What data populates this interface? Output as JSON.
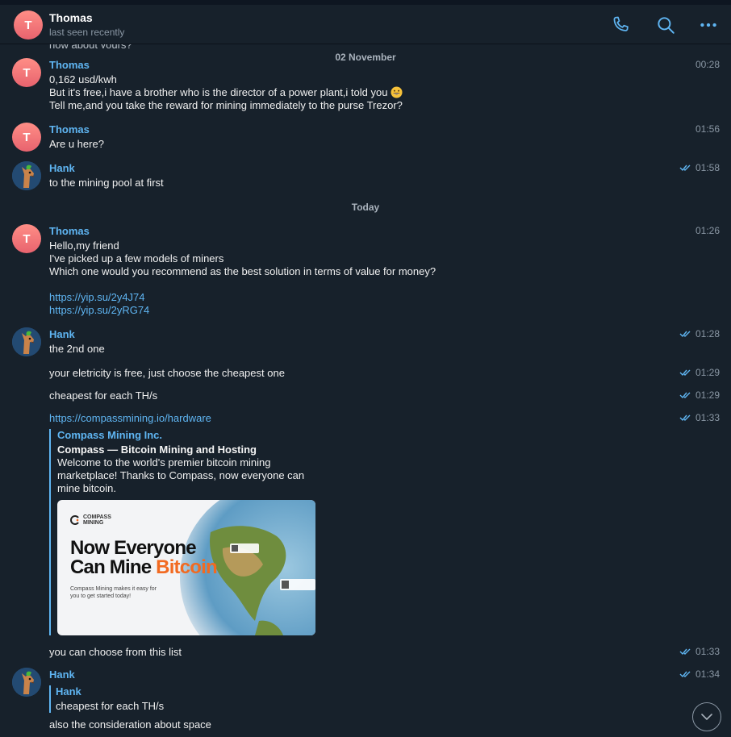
{
  "header": {
    "avatar_letter": "T",
    "name": "Thomas",
    "status": "last seen recently",
    "icons": [
      "phone-icon",
      "search-icon",
      "more-icon"
    ]
  },
  "cut_text": "now about yours?",
  "date_separators": [
    "02 November",
    "Today"
  ],
  "messages": [
    {
      "author": "Thomas",
      "time": "00:28",
      "lines": [
        "0,162 usd/kwh",
        "But it's free,i have a brother who is the director of a power plant,i told you",
        "Tell me,and you take the reward for mining immediately to the purse Trezor?"
      ]
    },
    {
      "author": "Thomas",
      "time": "01:56",
      "lines": [
        "Are u here?"
      ]
    },
    {
      "author": "Hank",
      "time": "01:58",
      "lines": [
        "to the mining pool at first"
      ]
    },
    {
      "author": "Thomas",
      "time": "01:26",
      "lines": [
        "Hello,my friend",
        "I've picked up a few models of miners",
        "Which one would you recommend as the best solution in terms of value for money?"
      ],
      "links": [
        "https://yip.su/2y4J74",
        "https://yip.su/2yRG74"
      ]
    },
    {
      "author": "Hank",
      "time": "01:28",
      "lines": [
        "the 2nd one"
      ]
    },
    {
      "time": "01:29",
      "lines": [
        "your eletricity is free, just choose the cheapest one"
      ]
    },
    {
      "time": "01:29",
      "lines": [
        "cheapest for each TH/s"
      ]
    },
    {
      "time": "01:33",
      "link": "https://compassmining.io/hardware"
    },
    {
      "time": "01:33",
      "lines": [
        "you can choose from this list"
      ]
    },
    {
      "author": "Hank",
      "time": "01:34",
      "lines": [
        "also the consideration about space"
      ]
    }
  ],
  "link_preview": {
    "site": "Compass Mining Inc.",
    "title": "Compass — Bitcoin Mining and Hosting",
    "description": "Welcome to the world's premier bitcoin mining marketplace! Thanks to Compass, now everyone can mine bitcoin.",
    "image": {
      "logo_line1": "COMPASS",
      "logo_line2": "MINING",
      "headline_line1": "Now Everyone",
      "headline_line2_a": "Can Mine ",
      "headline_line2_b": "Bitcoin",
      "subtext": "Compass Mining makes it easy for you to get started today!"
    }
  },
  "reply_quote": {
    "author": "Hank",
    "text": "cheapest for each TH/s"
  },
  "colors": {
    "background": "#17212b",
    "accent": "#5fb5f2",
    "muted": "#8a97a4",
    "bitcoin_orange": "#f26a21"
  }
}
